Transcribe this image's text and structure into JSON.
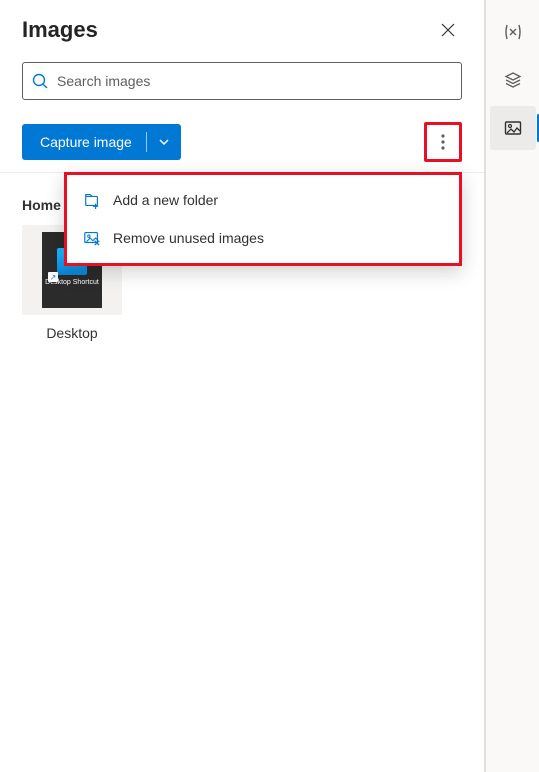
{
  "panel": {
    "title": "Images"
  },
  "search": {
    "placeholder": "Search images"
  },
  "toolbar": {
    "capture_label": "Capture image"
  },
  "breadcrumb": {
    "root": "Home"
  },
  "thumbnails": [
    {
      "label": "Desktop",
      "inner_caption": "Desktop Shortcut"
    }
  ],
  "context_menu": {
    "items": [
      {
        "label": "Add a new folder",
        "icon": "folder-add-icon"
      },
      {
        "label": "Remove unused images",
        "icon": "image-remove-icon"
      }
    ]
  },
  "rail": {
    "items": [
      {
        "name": "variables-icon"
      },
      {
        "name": "layers-icon"
      },
      {
        "name": "images-icon",
        "active": true
      }
    ]
  },
  "colors": {
    "primary": "#0078d4",
    "highlight": "#e81123"
  }
}
